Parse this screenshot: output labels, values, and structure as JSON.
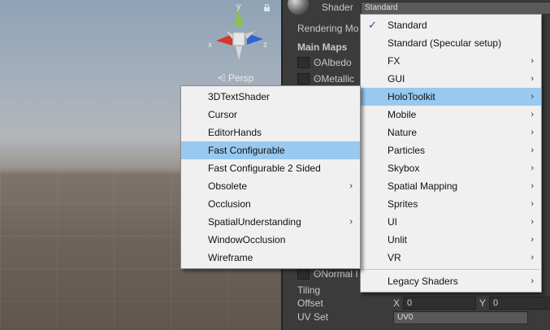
{
  "scene": {
    "gizmo_labels": {
      "y": "y",
      "x": "x",
      "z": "z"
    },
    "projection_label": "Persp",
    "colors": {
      "x_axis": "#d6362b",
      "y_axis": "#8bc34a",
      "z_axis": "#2f63d6"
    }
  },
  "inspector": {
    "shader_label": "Shader",
    "shader_value": "Standard",
    "rendering_mode_label": "Rendering Mo",
    "main_maps_label": "Main Maps",
    "albedo_label": "Albedo",
    "metallic_label": "Metallic",
    "normal_map_label": "Normal I",
    "tiling_label": "Tiling",
    "offset_label": "Offset",
    "offset_x_label": "X",
    "offset_x_value": "0",
    "offset_y_label": "Y",
    "offset_y_value": "0",
    "uv_set_label": "UV Set",
    "uv_set_value": "UV0"
  },
  "shader_menu": {
    "items": [
      {
        "label": "Standard",
        "checked": true,
        "submenu": false
      },
      {
        "label": "Standard (Specular setup)",
        "submenu": false
      },
      {
        "label": "FX",
        "submenu": true
      },
      {
        "label": "GUI",
        "submenu": true
      },
      {
        "label": "HoloToolkit",
        "submenu": true,
        "highlighted": true
      },
      {
        "label": "Mobile",
        "submenu": true
      },
      {
        "label": "Nature",
        "submenu": true
      },
      {
        "label": "Particles",
        "submenu": true
      },
      {
        "label": "Skybox",
        "submenu": true
      },
      {
        "label": "Spatial Mapping",
        "submenu": true
      },
      {
        "label": "Sprites",
        "submenu": true
      },
      {
        "label": "UI",
        "submenu": true
      },
      {
        "label": "Unlit",
        "submenu": true
      },
      {
        "label": "VR",
        "submenu": true
      },
      {
        "label": "Legacy Shaders",
        "submenu": true
      }
    ],
    "check_glyph": "✓",
    "arrow_glyph": "›"
  },
  "holotoolkit_menu": {
    "items": [
      {
        "label": "3DTextShader",
        "submenu": false
      },
      {
        "label": "Cursor",
        "submenu": false
      },
      {
        "label": "EditorHands",
        "submenu": false
      },
      {
        "label": "Fast Configurable",
        "submenu": false,
        "highlighted": true
      },
      {
        "label": "Fast Configurable 2 Sided",
        "submenu": false
      },
      {
        "label": "Obsolete",
        "submenu": true
      },
      {
        "label": "Occlusion",
        "submenu": false
      },
      {
        "label": "SpatialUnderstanding",
        "submenu": true
      },
      {
        "label": "WindowOcclusion",
        "submenu": false
      },
      {
        "label": "Wireframe",
        "submenu": false
      }
    ],
    "highlight_color": "#99c9ef"
  }
}
